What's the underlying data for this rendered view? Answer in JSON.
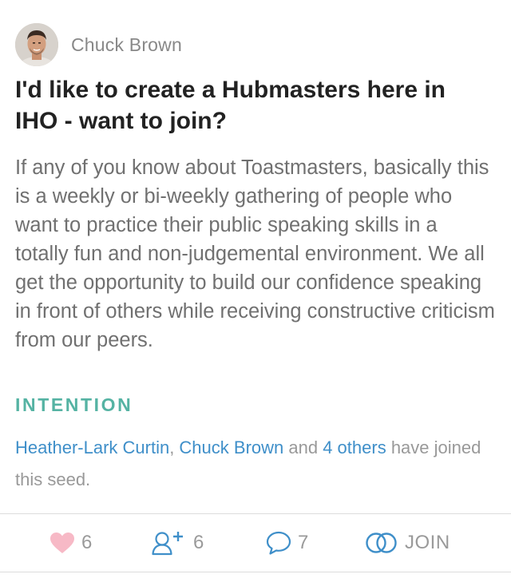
{
  "author": {
    "name": "Chuck Brown"
  },
  "post": {
    "title": "I'd like to create a Hubmasters here in IHO - want to join?",
    "body": "If any of you know about Toastmasters, basically this is a weekly or bi-weekly gathering of people who want to practice their public speaking skills in a totally fun and non-judgemental environment. We all get the opportunity to build our confidence speaking in front of others while receiving constructive criticism from our peers.",
    "category": "INTENTION"
  },
  "joined": {
    "member_1": "Heather-Lark Curtin",
    "separator": ", ",
    "member_2": "Chuck Brown",
    "connector": " and ",
    "others": "4 others",
    "suffix": " have joined this seed."
  },
  "actions": {
    "likes": "6",
    "members": "6",
    "comments": "7",
    "join_label": "JOIN"
  },
  "colors": {
    "heart": "#f7b9c6",
    "link": "#3f8fc9",
    "intention": "#55b3a3",
    "icon_blue": "#3f8fc9"
  },
  "icons": {
    "like": "heart-icon",
    "members": "add-user-icon",
    "comments": "speech-bubble-icon",
    "join": "interlocking-rings-icon"
  }
}
